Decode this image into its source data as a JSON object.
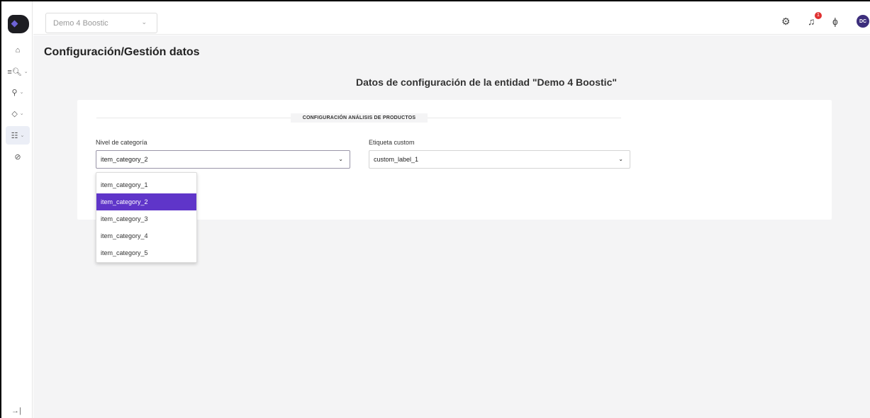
{
  "header": {
    "entity_select_value": "Demo 4 Boostic",
    "avatar_initials": "DC",
    "notification_count": "1"
  },
  "page": {
    "title": "Configuración/Gestión datos",
    "subtitle": "Datos de configuración de la entidad \"Demo 4 Boostic\""
  },
  "config": {
    "section_title": "CONFIGURACIÓN ANÁLISIS DE PRODUCTOS",
    "category_level": {
      "label": "Nivel de categoría",
      "value": "item_category_2",
      "options": [
        "item_category_1",
        "item_category_2",
        "item_category_3",
        "item_category_4",
        "item_category_5"
      ]
    },
    "custom_label": {
      "label": "Etiqueta custom",
      "value": "custom_label_1"
    }
  },
  "icons": {
    "home": "home-icon",
    "search_list": "search-list-icon",
    "search": "search-icon",
    "tag": "tag-icon",
    "sliders": "sliders-icon",
    "gauge": "gauge-icon",
    "settings": "gear-icon",
    "bell": "bell-icon",
    "plug": "plug-icon",
    "collapse": "expand-sidebar-icon"
  },
  "colors": {
    "accent": "#5f35c9",
    "badge": "#e03131",
    "avatar": "#3c2e7c"
  }
}
